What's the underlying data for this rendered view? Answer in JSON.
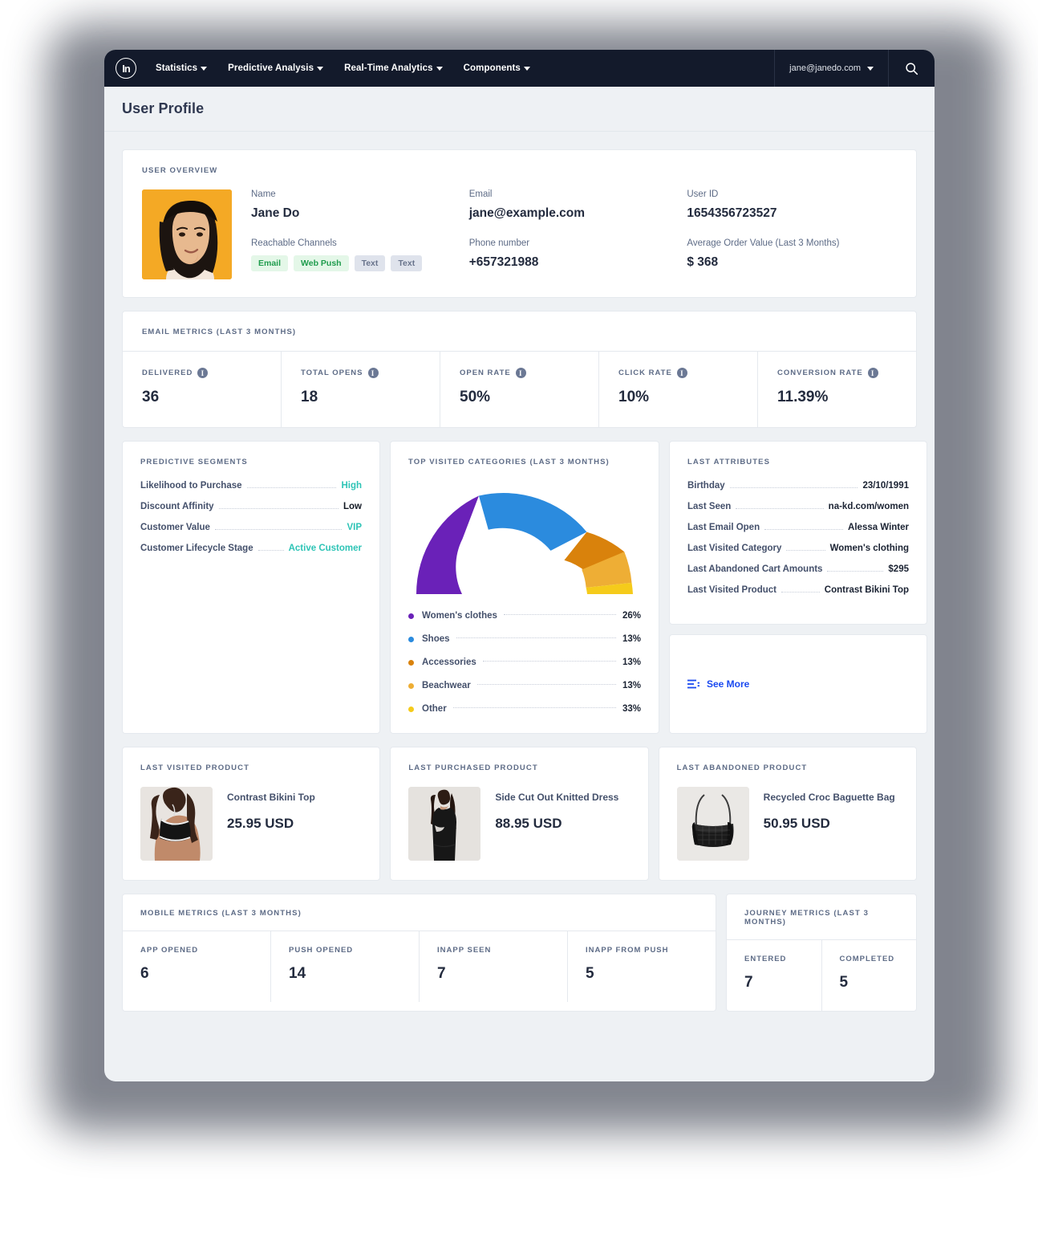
{
  "nav": {
    "logo_text": "In",
    "items": [
      {
        "label": "Statistics",
        "icon": "chevron-down-icon"
      },
      {
        "label": "Predictive Analysis",
        "icon": "chevron-down-icon"
      },
      {
        "label": "Real-Time Analytics",
        "icon": "chevron-down-icon"
      },
      {
        "label": "Components",
        "icon": "chevron-down-icon"
      }
    ],
    "user_email": "jane@janedo.com",
    "search_icon": "search-icon"
  },
  "page": {
    "title": "User Profile"
  },
  "overview": {
    "title": "USER OVERVIEW",
    "name_label": "Name",
    "name_value": "Jane Do",
    "email_label": "Email",
    "email_value": "jane@example.com",
    "userid_label": "User ID",
    "userid_value": "1654356723527",
    "channels_label": "Reachable Channels",
    "channels": [
      {
        "label": "Email",
        "state": "on"
      },
      {
        "label": "Web Push",
        "state": "on"
      },
      {
        "label": "Text",
        "state": "off"
      },
      {
        "label": "Text",
        "state": "off"
      }
    ],
    "phone_label": "Phone number",
    "phone_value": "+657321988",
    "aov_label": "Average Order Value (Last 3 Months)",
    "aov_value": "$ 368"
  },
  "email_metrics": {
    "title": "EMAIL METRICS (LAST 3 MONTHS)",
    "cells": [
      {
        "label": "DELIVERED",
        "value": "36",
        "icon": "info-icon"
      },
      {
        "label": "TOTAL OPENS",
        "value": "18",
        "icon": "info-icon"
      },
      {
        "label": "OPEN RATE",
        "value": "50%",
        "icon": "info-icon"
      },
      {
        "label": "CLICK RATE",
        "value": "10%",
        "icon": "info-icon"
      },
      {
        "label": "CONVERSION RATE",
        "value": "11.39%",
        "icon": "info-icon"
      }
    ]
  },
  "predictive": {
    "title": "PREDICTIVE SEGMENTS",
    "rows": [
      {
        "key": "Likelihood to Purchase",
        "value": "High",
        "tone": "teal"
      },
      {
        "key": "Discount Affinity",
        "value": "Low",
        "tone": "dark"
      },
      {
        "key": "Customer Value",
        "value": "VIP",
        "tone": "teal"
      },
      {
        "key": "Customer Lifecycle Stage",
        "value": "Active Customer",
        "tone": "teal"
      }
    ]
  },
  "categories": {
    "title": "TOP VISITED CATEGORIES (LAST 3 MONTHS)"
  },
  "chart_data": {
    "type": "pie",
    "title": "TOP VISITED CATEGORIES (LAST 3 MONTHS)",
    "subtype": "half-donut-gauge",
    "categories": [
      "Women's clothes",
      "Shoes",
      "Accessories",
      "Beachwear",
      "Other"
    ],
    "values": [
      26,
      13,
      13,
      13,
      33
    ],
    "value_labels": [
      "26%",
      "13%",
      "13%",
      "13%",
      "33%"
    ],
    "colors": [
      "#6a21b8",
      "#2b8bde",
      "#d9820c",
      "#eeae35",
      "#f5cb1b"
    ],
    "unit": "%",
    "legend_position": "bottom",
    "grid": false
  },
  "attributes": {
    "title": "LAST ATTRIBUTES",
    "rows": [
      {
        "key": "Birthday",
        "value": "23/10/1991"
      },
      {
        "key": "Last Seen",
        "value": "na-kd.com/women"
      },
      {
        "key": "Last Email Open",
        "value": "Alessa Winter"
      },
      {
        "key": "Last Visited Category",
        "value": "Women's clothing"
      },
      {
        "key": "Last Abandoned Cart Amounts",
        "value": "$295"
      },
      {
        "key": "Last Visited Product",
        "value": "Contrast Bikini Top"
      }
    ],
    "see_more_label": "See More",
    "see_more_icon": "list-lines-icon"
  },
  "products": [
    {
      "title": "LAST VISITED PRODUCT",
      "name": "Contrast Bikini Top",
      "price": "25.95 USD",
      "image": "bikini-top-photo"
    },
    {
      "title": "LAST PURCHASED PRODUCT",
      "name": "Side Cut Out Knitted Dress",
      "price": "88.95 USD",
      "image": "knitted-dress-photo"
    },
    {
      "title": "LAST ABANDONED PRODUCT",
      "name": "Recycled Croc Baguette Bag",
      "price": "50.95 USD",
      "image": "baguette-bag-photo"
    }
  ],
  "mobile_metrics": {
    "title": "MOBILE METRICS (LAST 3 MONTHS)",
    "cells": [
      {
        "label": "APP OPENED",
        "value": "6"
      },
      {
        "label": "PUSH OPENED",
        "value": "14"
      },
      {
        "label": "INAPP SEEN",
        "value": "7"
      },
      {
        "label": "INAPP FROM PUSH",
        "value": "5"
      }
    ]
  },
  "journey_metrics": {
    "title": "JOURNEY METRICS (LAST 3 MONTHS)",
    "cells": [
      {
        "label": "ENTERED",
        "value": "7"
      },
      {
        "label": "COMPLETED",
        "value": "5"
      }
    ]
  },
  "theme": {
    "nav_bg": "#131a2b",
    "page_bg": "#eef1f4",
    "accent_teal": "#2ec4b6",
    "accent_blue": "#1a49f0",
    "text_dark": "#232b3e",
    "text_muted": "#5d6b86"
  }
}
